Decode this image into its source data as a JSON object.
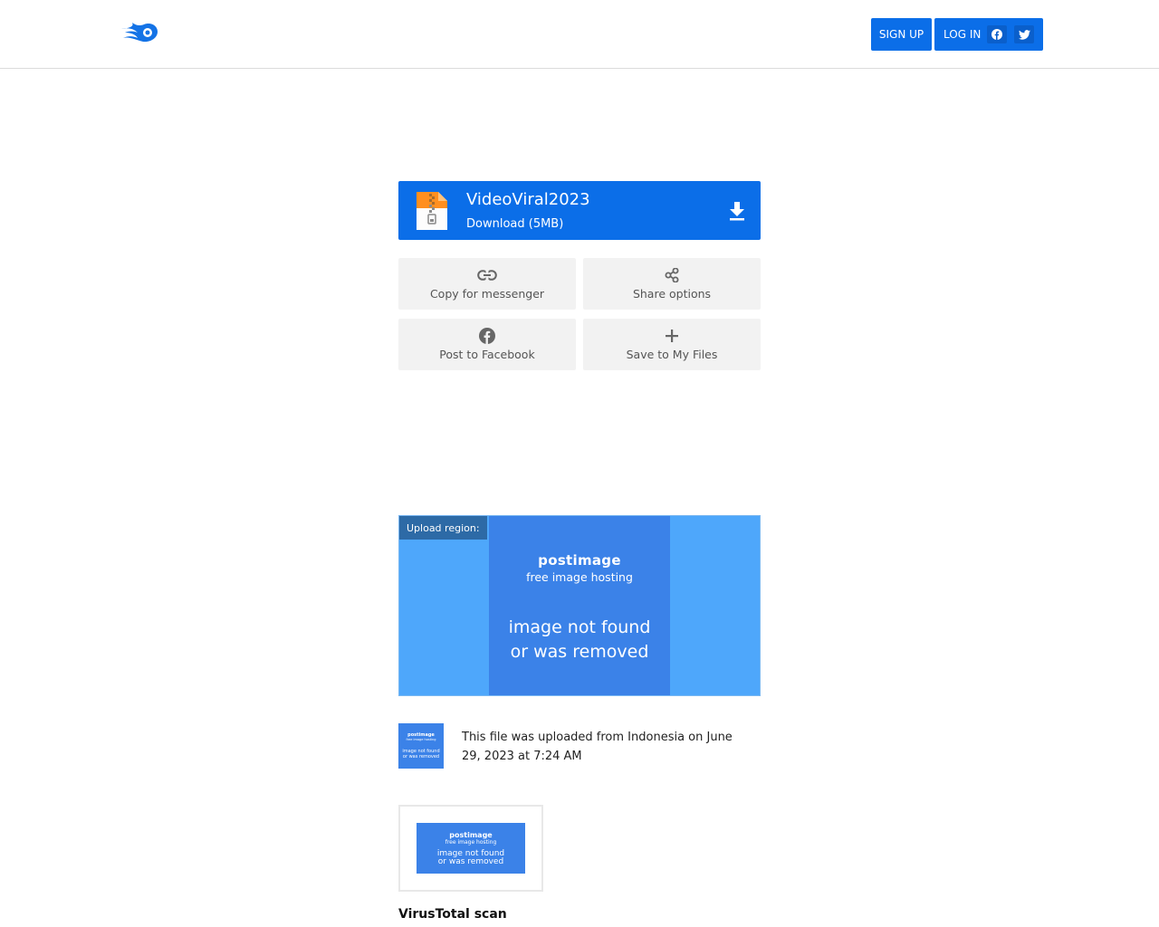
{
  "header": {
    "signup_label": "SIGN UP",
    "login_label": "LOG IN",
    "brand_color": "#0b6ee8"
  },
  "file": {
    "name": "VideoViral2023",
    "download_label": "Download (5MB)",
    "icon": "zip-file-icon"
  },
  "actions": {
    "copy": {
      "label": "Copy for messenger",
      "icon": "link-icon"
    },
    "share": {
      "label": "Share options",
      "icon": "share-icon"
    },
    "facebook": {
      "label": "Post to Facebook",
      "icon": "facebook-icon"
    },
    "save": {
      "label": "Save to My Files",
      "icon": "plus-icon"
    }
  },
  "region": {
    "tag": "Upload region:",
    "placeholder_brand": "postimage",
    "placeholder_sub": "free image hosting",
    "placeholder_msg_line1": "image not found",
    "placeholder_msg_line2": "or was removed"
  },
  "upload": {
    "info": "This file was uploaded from Indonesia on June 29, 2023 at 7:24 AM"
  },
  "virustotal": {
    "title": "VirusTotal scan"
  }
}
